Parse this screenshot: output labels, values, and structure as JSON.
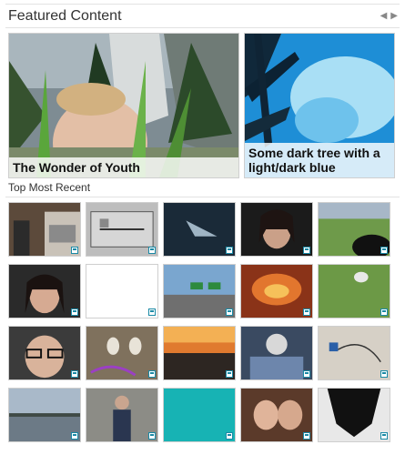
{
  "header": {
    "title": "Featured Content",
    "prev_icon": "chevron-left-icon",
    "next_icon": "chevron-right-icon",
    "prev_glyph": "◀",
    "next_glyph": "▶"
  },
  "featured": [
    {
      "caption": "The Wonder of Youth"
    },
    {
      "caption": "Some dark tree with a light/dark blue"
    }
  ],
  "recent": {
    "title": "Top Most Recent",
    "badge_icon": "media-type-icon"
  }
}
